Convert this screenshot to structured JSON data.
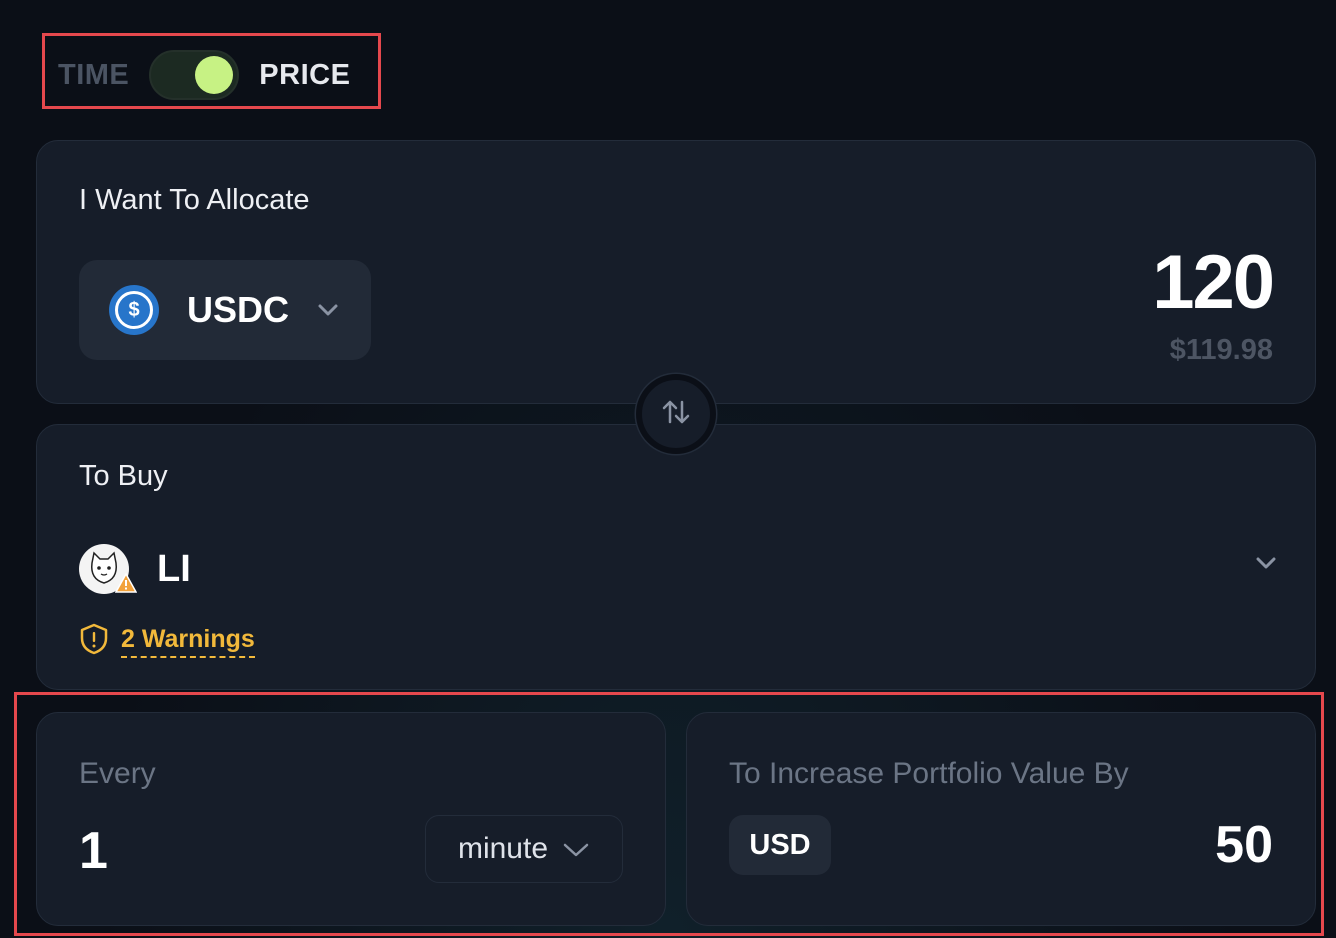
{
  "mode_toggle": {
    "left_label": "TIME",
    "right_label": "PRICE",
    "active": "PRICE"
  },
  "allocate": {
    "title": "I Want To Allocate",
    "token": "USDC",
    "token_icon": "usdc-icon",
    "amount": "120",
    "amount_usd": "$119.98"
  },
  "swap": {
    "icon": "swap-arrows-icon"
  },
  "buy": {
    "title": "To Buy",
    "token": "LI",
    "token_icon": "cat-avatar-icon",
    "warnings": "2 Warnings"
  },
  "every": {
    "label": "Every",
    "value": "1",
    "unit": "minute"
  },
  "increase": {
    "label": "To Increase Portfolio Value By",
    "currency": "USD",
    "value": "50"
  },
  "colors": {
    "accent": "#c7f284",
    "warning": "#f2b93b",
    "highlight": "#e5484d",
    "card": "#161d29"
  }
}
